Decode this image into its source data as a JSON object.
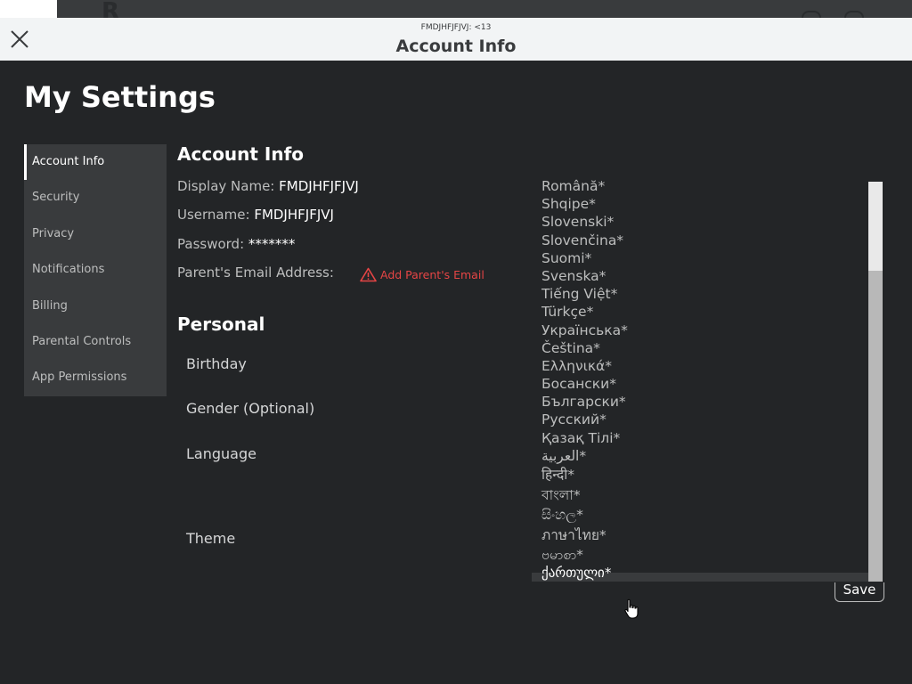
{
  "header": {
    "subtitle": "FMDJHFJFJVJ: <13",
    "title": "Account Info"
  },
  "page_title": "My Settings",
  "sidebar": {
    "items": [
      {
        "label": "Account Info",
        "active": true
      },
      {
        "label": "Security"
      },
      {
        "label": "Privacy"
      },
      {
        "label": "Notifications"
      },
      {
        "label": "Billing"
      },
      {
        "label": "Parental Controls"
      },
      {
        "label": "App Permissions"
      }
    ]
  },
  "account": {
    "heading": "Account Info",
    "display_name_label": "Display Name:",
    "display_name": "FMDJHFJFJVJ",
    "username_label": "Username:",
    "username": "FMDJHFJFJVJ",
    "password_label": "Password:",
    "password": "*******",
    "parent_email_label": "Parent's Email Address:",
    "add_parent_email": "Add Parent's Email"
  },
  "personal": {
    "heading": "Personal",
    "birthday": "Birthday",
    "gender": "Gender (Optional)",
    "language": "Language",
    "theme": "Theme"
  },
  "language_dropdown": {
    "options": [
      "Română*",
      "Shqipe*",
      "Slovenski*",
      "Slovenčina*",
      "Suomi*",
      "Svenska*",
      "Tiếng Việt*",
      "Türkçe*",
      "Українська*",
      "Čeština*",
      "Ελληνικά*",
      "Босански*",
      "Български*",
      "Русский*",
      "Қазақ Тілі*",
      "العربية*",
      "हिन्दी*",
      "বাংলা*",
      "සිංහල*",
      "ภาษาไทย*",
      "ဗမာစာ*"
    ],
    "partially_visible_option": "ქართული*"
  },
  "save_label": "Save",
  "colors": {
    "background": "#232527",
    "panel": "#393b3d",
    "titlebar": "#f2f4f5",
    "warning": "#e64545"
  }
}
